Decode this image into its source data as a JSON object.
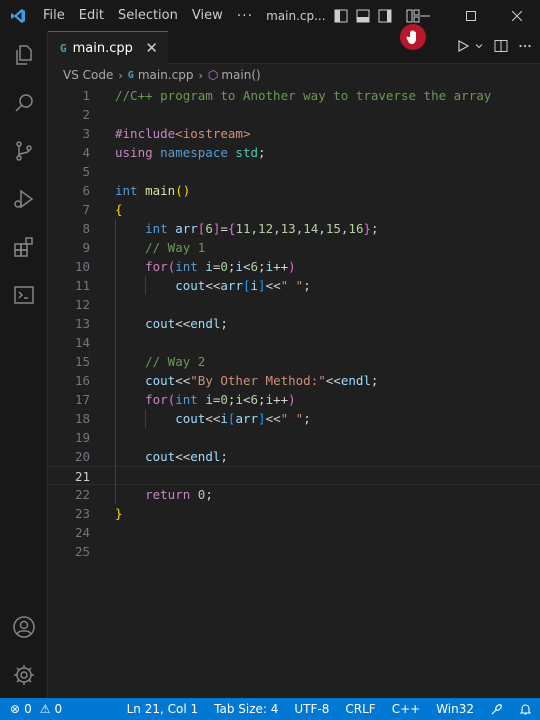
{
  "titlebar": {
    "menu": [
      "File",
      "Edit",
      "Selection",
      "View"
    ],
    "more": "···",
    "window_title": "main.cp..."
  },
  "activity_bar": {
    "items": [
      "explorer-icon",
      "search-icon",
      "source-control-icon",
      "run-debug-icon",
      "extensions-icon",
      "terminal-icon"
    ],
    "bottom": [
      "account-icon",
      "settings-gear-icon"
    ]
  },
  "tab": {
    "icon": "G",
    "label": "main.cpp",
    "close": "✕"
  },
  "breadcrumb": {
    "root": "VS Code",
    "file": "main.cpp",
    "symbol": "main()"
  },
  "editor": {
    "current_line": 21,
    "line_numbers": [
      "1",
      "2",
      "3",
      "4",
      "5",
      "6",
      "7",
      "8",
      "9",
      "10",
      "11",
      "12",
      "13",
      "14",
      "15",
      "16",
      "17",
      "18",
      "19",
      "20",
      "21",
      "22",
      "23",
      "24",
      "25"
    ]
  },
  "code_lines": [
    [
      [
        "//C++ program to Another way to traverse the array",
        "c-comment"
      ]
    ],
    [],
    [
      [
        "#include",
        "c-prepro"
      ],
      [
        "<iostream>",
        "c-inc"
      ]
    ],
    [
      [
        "using ",
        "c-ctrl"
      ],
      [
        "namespace ",
        "c-kw"
      ],
      [
        "std",
        "c-ns"
      ],
      [
        ";",
        "c-plain"
      ]
    ],
    [],
    [
      [
        "int ",
        "c-kw"
      ],
      [
        "main",
        "c-fn"
      ],
      [
        "()",
        "c-brace"
      ]
    ],
    [
      [
        "{",
        "c-brace"
      ]
    ],
    [
      [
        "    ",
        "c-plain"
      ],
      [
        "int ",
        "c-kw"
      ],
      [
        "arr",
        "c-var"
      ],
      [
        "[",
        "c-paren"
      ],
      [
        "6",
        "c-num"
      ],
      [
        "]",
        "c-paren"
      ],
      [
        "=",
        "c-op"
      ],
      [
        "{",
        "c-paren"
      ],
      [
        "11",
        "c-num"
      ],
      [
        ",",
        "c-plain"
      ],
      [
        "12",
        "c-num"
      ],
      [
        ",",
        "c-plain"
      ],
      [
        "13",
        "c-num"
      ],
      [
        ",",
        "c-plain"
      ],
      [
        "14",
        "c-num"
      ],
      [
        ",",
        "c-plain"
      ],
      [
        "15",
        "c-num"
      ],
      [
        ",",
        "c-plain"
      ],
      [
        "16",
        "c-num"
      ],
      [
        "}",
        "c-paren"
      ],
      [
        ";",
        "c-plain"
      ]
    ],
    [
      [
        "    ",
        "c-plain"
      ],
      [
        "// Way 1",
        "c-comment"
      ]
    ],
    [
      [
        "    ",
        "c-plain"
      ],
      [
        "for",
        "c-ctrl"
      ],
      [
        "(",
        "c-paren"
      ],
      [
        "int ",
        "c-kw"
      ],
      [
        "i",
        "c-var"
      ],
      [
        "=",
        "c-op"
      ],
      [
        "0",
        "c-num"
      ],
      [
        ";",
        "c-plain"
      ],
      [
        "i",
        "c-var"
      ],
      [
        "<",
        "c-op"
      ],
      [
        "6",
        "c-num"
      ],
      [
        ";",
        "c-plain"
      ],
      [
        "i",
        "c-var"
      ],
      [
        "++",
        "c-op"
      ],
      [
        ")",
        "c-paren"
      ]
    ],
    [
      [
        "        ",
        "c-plain"
      ],
      [
        "cout",
        "c-var"
      ],
      [
        "<<",
        "c-op"
      ],
      [
        "arr",
        "c-var"
      ],
      [
        "[",
        "c-brk"
      ],
      [
        "i",
        "c-var"
      ],
      [
        "]",
        "c-brk"
      ],
      [
        "<<",
        "c-op"
      ],
      [
        "\" \"",
        "c-str"
      ],
      [
        ";",
        "c-plain"
      ]
    ],
    [],
    [
      [
        "    ",
        "c-plain"
      ],
      [
        "cout",
        "c-var"
      ],
      [
        "<<",
        "c-op"
      ],
      [
        "endl",
        "c-var"
      ],
      [
        ";",
        "c-plain"
      ]
    ],
    [],
    [
      [
        "    ",
        "c-plain"
      ],
      [
        "// Way 2",
        "c-comment"
      ]
    ],
    [
      [
        "    ",
        "c-plain"
      ],
      [
        "cout",
        "c-var"
      ],
      [
        "<<",
        "c-op"
      ],
      [
        "\"By Other Method:\"",
        "c-str"
      ],
      [
        "<<",
        "c-op"
      ],
      [
        "endl",
        "c-var"
      ],
      [
        ";",
        "c-plain"
      ]
    ],
    [
      [
        "    ",
        "c-plain"
      ],
      [
        "for",
        "c-ctrl"
      ],
      [
        "(",
        "c-paren"
      ],
      [
        "int ",
        "c-kw"
      ],
      [
        "i",
        "c-var"
      ],
      [
        "=",
        "c-op"
      ],
      [
        "0",
        "c-num"
      ],
      [
        ";",
        "c-plain"
      ],
      [
        "i",
        "c-var"
      ],
      [
        "<",
        "c-op"
      ],
      [
        "6",
        "c-num"
      ],
      [
        ";",
        "c-plain"
      ],
      [
        "i",
        "c-var"
      ],
      [
        "++",
        "c-op"
      ],
      [
        ")",
        "c-paren"
      ]
    ],
    [
      [
        "        ",
        "c-plain"
      ],
      [
        "cout",
        "c-var"
      ],
      [
        "<<",
        "c-op"
      ],
      [
        "i",
        "c-var"
      ],
      [
        "[",
        "c-brk"
      ],
      [
        "arr",
        "c-var"
      ],
      [
        "]",
        "c-brk"
      ],
      [
        "<<",
        "c-op"
      ],
      [
        "\" \"",
        "c-str"
      ],
      [
        ";",
        "c-plain"
      ]
    ],
    [],
    [
      [
        "    ",
        "c-plain"
      ],
      [
        "cout",
        "c-var"
      ],
      [
        "<<",
        "c-op"
      ],
      [
        "endl",
        "c-var"
      ],
      [
        ";",
        "c-plain"
      ]
    ],
    [],
    [
      [
        "    ",
        "c-plain"
      ],
      [
        "return ",
        "c-ctrl"
      ],
      [
        "0",
        "c-num"
      ],
      [
        ";",
        "c-plain"
      ]
    ],
    [
      [
        "}",
        "c-brace"
      ]
    ],
    [],
    []
  ],
  "statusbar": {
    "errors": "0",
    "warnings": "0",
    "position": "Ln 21, Col 1",
    "tab_size": "Tab Size: 4",
    "encoding": "UTF-8",
    "eol": "CRLF",
    "language": "C++",
    "platform": "Win32"
  },
  "colors": {
    "accent": "#0078d4",
    "editor_bg": "#1f1f1f",
    "sidebar_bg": "#181818"
  }
}
